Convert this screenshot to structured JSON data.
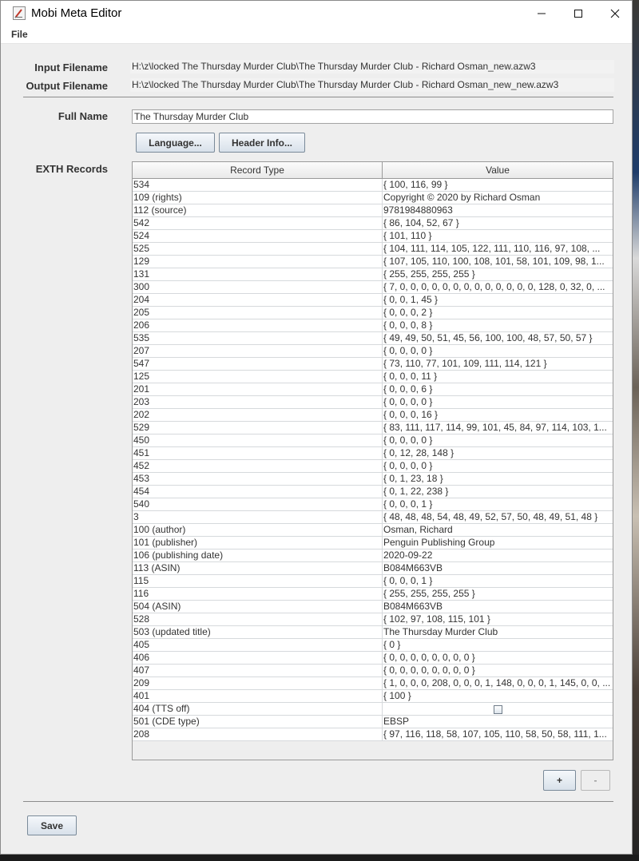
{
  "window": {
    "title": "Mobi Meta Editor"
  },
  "menu": {
    "file": "File"
  },
  "form": {
    "input_label": "Input Filename",
    "input_value": "H:\\z\\locked The Thursday Murder Club\\The Thursday Murder Club - Richard Osman_new.azw3",
    "output_label": "Output Filename",
    "output_value": "H:\\z\\locked The Thursday Murder Club\\The Thursday Murder Club - Richard Osman_new_new.azw3",
    "fullname_label": "Full Name",
    "fullname_value": "The Thursday Murder Club",
    "language_button": "Language...",
    "header_info_button": "Header Info...",
    "exth_label": "EXTH Records"
  },
  "table": {
    "columns": [
      "Record Type",
      "Value"
    ],
    "rows": [
      {
        "type": "534",
        "value": "{ 100, 116, 99 }"
      },
      {
        "type": "109 (rights)",
        "value": "Copyright © 2020 by Richard Osman"
      },
      {
        "type": "112 (source)",
        "value": "9781984880963"
      },
      {
        "type": "542",
        "value": "{ 86, 104, 52, 67 }"
      },
      {
        "type": "524",
        "value": "{ 101, 110 }"
      },
      {
        "type": "525",
        "value": "{ 104, 111, 114, 105, 122, 111, 110, 116, 97, 108, ..."
      },
      {
        "type": "129",
        "value": "{ 107, 105, 110, 100, 108, 101, 58, 101, 109, 98, 1..."
      },
      {
        "type": "131",
        "value": "{ 255, 255, 255, 255 }"
      },
      {
        "type": "300",
        "value": "{ 7, 0, 0, 0, 0, 0, 0, 0, 0, 0, 0, 0, 0, 0, 128, 0, 32, 0, ..."
      },
      {
        "type": "204",
        "value": "{ 0, 0, 1, 45 }"
      },
      {
        "type": "205",
        "value": "{ 0, 0, 0, 2 }"
      },
      {
        "type": "206",
        "value": "{ 0, 0, 0, 8 }"
      },
      {
        "type": "535",
        "value": "{ 49, 49, 50, 51, 45, 56, 100, 100, 48, 57, 50, 57 }"
      },
      {
        "type": "207",
        "value": "{ 0, 0, 0, 0 }"
      },
      {
        "type": "547",
        "value": "{ 73, 110, 77, 101, 109, 111, 114, 121 }"
      },
      {
        "type": "125",
        "value": "{ 0, 0, 0, 11 }"
      },
      {
        "type": "201",
        "value": "{ 0, 0, 0, 6 }"
      },
      {
        "type": "203",
        "value": "{ 0, 0, 0, 0 }"
      },
      {
        "type": "202",
        "value": "{ 0, 0, 0, 16 }"
      },
      {
        "type": "529",
        "value": "{ 83, 111, 117, 114, 99, 101, 45, 84, 97, 114, 103, 1..."
      },
      {
        "type": "450",
        "value": "{ 0, 0, 0, 0 }"
      },
      {
        "type": "451",
        "value": "{ 0, 12, 28, 148 }"
      },
      {
        "type": "452",
        "value": "{ 0, 0, 0, 0 }"
      },
      {
        "type": "453",
        "value": "{ 0, 1, 23, 18 }"
      },
      {
        "type": "454",
        "value": "{ 0, 1, 22, 238 }"
      },
      {
        "type": "540",
        "value": "{ 0, 0, 0, 1 }"
      },
      {
        "type": "3",
        "value": "{ 48, 48, 48, 54, 48, 49, 52, 57, 50, 48, 49, 51, 48 }"
      },
      {
        "type": "100 (author)",
        "value": "Osman, Richard"
      },
      {
        "type": "101 (publisher)",
        "value": "Penguin Publishing Group"
      },
      {
        "type": "106 (publishing date)",
        "value": "2020-09-22"
      },
      {
        "type": "113 (ASIN)",
        "value": "B084M663VB"
      },
      {
        "type": "115",
        "value": "{ 0, 0, 0, 1 }"
      },
      {
        "type": "116",
        "value": "{ 255, 255, 255, 255 }"
      },
      {
        "type": "504 (ASIN)",
        "value": "B084M663VB"
      },
      {
        "type": "528",
        "value": "{ 102, 97, 108, 115, 101 }"
      },
      {
        "type": "503 (updated title)",
        "value": "The Thursday Murder Club"
      },
      {
        "type": "405",
        "value": "{ 0 }"
      },
      {
        "type": "406",
        "value": "{ 0, 0, 0, 0, 0, 0, 0, 0 }"
      },
      {
        "type": "407",
        "value": "{ 0, 0, 0, 0, 0, 0, 0, 0 }"
      },
      {
        "type": "209",
        "value": "{ 1, 0, 0, 0, 208, 0, 0, 0, 1, 148, 0, 0, 0, 1, 145, 0, 0, ..."
      },
      {
        "type": "401",
        "value": "{ 100 }"
      },
      {
        "type": "404 (TTS off)",
        "value": "",
        "checkbox": true,
        "checked": false
      },
      {
        "type": "501 (CDE type)",
        "value": "EBSP"
      },
      {
        "type": "208",
        "value": "{ 97, 116, 118, 58, 107, 105, 110, 58, 50, 58, 111, 1..."
      }
    ]
  },
  "actions": {
    "add": "+",
    "remove": "-",
    "save": "Save"
  },
  "icons": {
    "app": "app-icon",
    "minimize": "minimize-icon",
    "maximize": "maximize-icon",
    "close": "close-icon",
    "checkbox": "checkbox-icon"
  }
}
